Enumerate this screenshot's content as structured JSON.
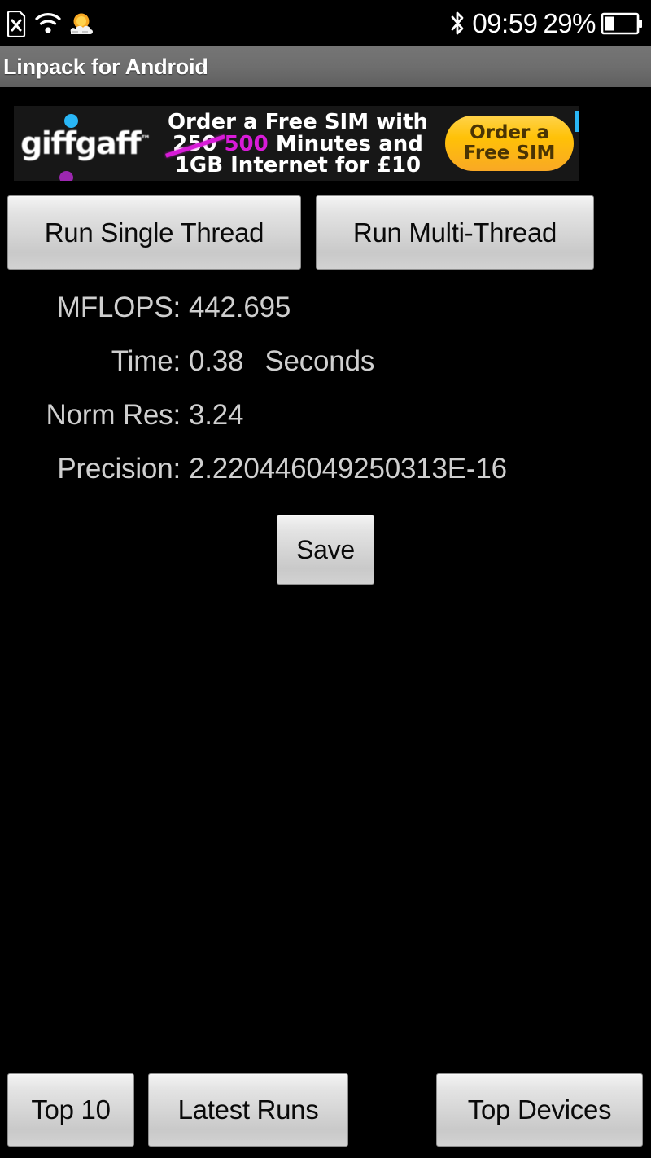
{
  "statusbar": {
    "icons_left": [
      "sdcard-missing-icon",
      "wifi-icon",
      "weather-icon"
    ],
    "bluetooth_icon": "bluetooth-icon",
    "time": "09:59",
    "battery_percent": "29%",
    "battery_icon": "battery-icon",
    "battery_level": 29
  },
  "titlebar": {
    "title": "Linpack for Android"
  },
  "ad": {
    "brand": "giffgaff",
    "trademark": "™",
    "line1": "Order a Free SIM with",
    "line2_old": "250",
    "line2_new": "500",
    "line2_rest": "Minutes and",
    "line3": "1GB Internet for £10",
    "cta_line1": "Order a",
    "cta_line2": "Free SIM",
    "accent_color": "#ffc107",
    "highlight_color": "#d81bd8",
    "dot_blue_color": "#29b6f6",
    "dot_purple_color": "#9c27b0"
  },
  "actions": {
    "run_single": "Run Single Thread",
    "run_multi": "Run Multi-Thread",
    "save": "Save"
  },
  "results": [
    {
      "label": "MFLOPS:",
      "value": "442.695",
      "unit": ""
    },
    {
      "label": "Time:",
      "value": "0.38",
      "unit": "Seconds"
    },
    {
      "label": "Norm Res:",
      "value": "3.24",
      "unit": ""
    },
    {
      "label": "Precision:",
      "value": "2.220446049250313E-16",
      "unit": ""
    }
  ],
  "results_flat": {
    "mflops_label": "MFLOPS:",
    "mflops_value": "442.695",
    "time_label": "Time:",
    "time_value": "0.38",
    "time_unit": "Seconds",
    "normres_label": "Norm Res:",
    "normres_value": "3.24",
    "precision_label": "Precision:",
    "precision_value": "2.220446049250313E-16"
  },
  "bottombar": {
    "top10": "Top 10",
    "latest_runs": "Latest Runs",
    "top_devices": "Top Devices"
  }
}
